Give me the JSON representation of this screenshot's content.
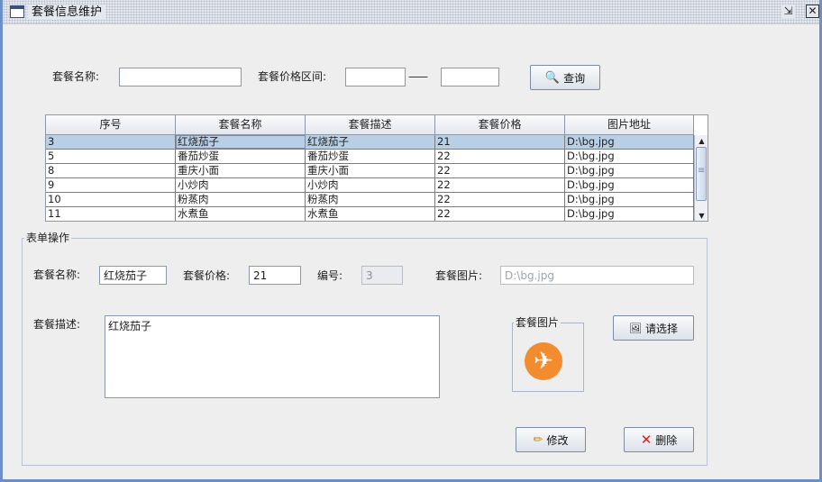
{
  "window": {
    "title": "套餐信息维护",
    "restore_glyph": "⇲",
    "close_glyph": "✕"
  },
  "search": {
    "name_label": "套餐名称:",
    "name_value": "",
    "price_label": "套餐价格区间:",
    "price_min": "",
    "separator": "——",
    "price_max": "",
    "query_label": "查询",
    "query_icon": "search-icon"
  },
  "table": {
    "columns": [
      "序号",
      "套餐名称",
      "套餐描述",
      "套餐价格",
      "图片地址"
    ],
    "rows": [
      [
        "3",
        "红烧茄子",
        "红烧茄子",
        "21",
        "D:\\bg.jpg"
      ],
      [
        "5",
        "番茄炒蛋",
        "番茄炒蛋",
        "22",
        "D:\\bg.jpg"
      ],
      [
        "8",
        "重庆小面",
        "重庆小面",
        "22",
        "D:\\bg.jpg"
      ],
      [
        "9",
        "小炒肉",
        "小炒肉",
        "22",
        "D:\\bg.jpg"
      ],
      [
        "10",
        "粉蒸肉",
        "粉蒸肉",
        "22",
        "D:\\bg.jpg"
      ],
      [
        "11",
        "水煮鱼",
        "水煮鱼",
        "22",
        "D:\\bg.jpg"
      ]
    ],
    "selected_row": 0
  },
  "form": {
    "group_title": "表单操作",
    "name_label": "套餐名称:",
    "name_value": "红烧茄子",
    "price_label": "套餐价格:",
    "price_value": "21",
    "id_label": "编号:",
    "id_value": "3",
    "image_label": "套餐图片:",
    "image_value": "D:\\bg.jpg",
    "desc_label": "套餐描述:",
    "desc_value": "红烧茄子",
    "image_box_title": "套餐图片",
    "image_icon": "airplane-icon",
    "choose_label": "请选择",
    "modify_label": "修改",
    "delete_label": "删除"
  },
  "colors": {
    "accent_orange": "#f28c2f",
    "selection": "#b8cfe5",
    "frame": "#6d8fc8"
  }
}
